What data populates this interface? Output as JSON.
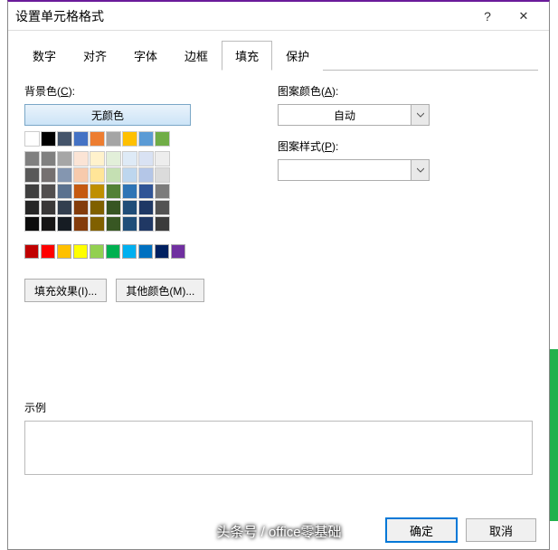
{
  "title": "设置单元格格式",
  "tabs": [
    "数字",
    "对齐",
    "字体",
    "边框",
    "填充",
    "保护"
  ],
  "active_tab": 4,
  "left": {
    "bg_label": "背景色",
    "bg_akey": "C",
    "no_color": "无颜色",
    "theme_top": [
      "#ffffff",
      "#000000",
      "#44546a",
      "#4472c4",
      "#ed7d31",
      "#a5a5a5",
      "#ffc000",
      "#5b9bd5",
      "#70ad47"
    ],
    "theme_shades": [
      [
        "#808080",
        "#808080",
        "#a6a6a6",
        "#fbe4d5",
        "#fff2cc",
        "#e2efd9",
        "#deeaf6",
        "#d9e2f3",
        "#ededed"
      ],
      [
        "#595959",
        "#757070",
        "#8496b0",
        "#f7caac",
        "#ffe598",
        "#c5e0b3",
        "#bdd6ee",
        "#b4c6e7",
        "#dbdbdb"
      ],
      [
        "#3f3f3f",
        "#524f4f",
        "#5b728f",
        "#c55a11",
        "#bf8f00",
        "#538135",
        "#2e74b5",
        "#2f5496",
        "#7b7b7b"
      ],
      [
        "#262626",
        "#3a3838",
        "#333f4f",
        "#833c0b",
        "#7f6000",
        "#375623",
        "#1f4d78",
        "#1f3864",
        "#525252"
      ],
      [
        "#0c0c0c",
        "#171616",
        "#161c23",
        "#843c0b",
        "#806000",
        "#385723",
        "#1f4e79",
        "#203864",
        "#3b3b3b"
      ]
    ],
    "standard": [
      "#c00000",
      "#ff0000",
      "#ffc000",
      "#ffff00",
      "#92d050",
      "#00b050",
      "#00b0f0",
      "#0070c0",
      "#002060",
      "#7030a0"
    ],
    "fill_effects": "填充效果(I)...",
    "other_colors": "其他颜色(M)..."
  },
  "right": {
    "pattern_color_label": "图案颜色",
    "pattern_color_akey": "A",
    "pattern_color_value": "自动",
    "pattern_style_label": "图案样式",
    "pattern_style_akey": "P",
    "pattern_style_value": ""
  },
  "sample_label": "示例",
  "footer": {
    "ok": "确定",
    "cancel": "取消"
  },
  "watermark": "头条号 / office零基础"
}
